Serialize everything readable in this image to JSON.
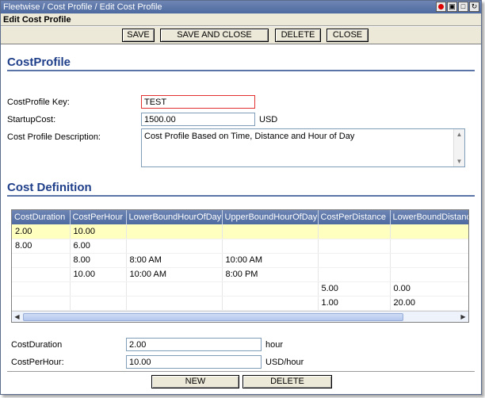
{
  "window": {
    "breadcrumb": "Fleetwise / Cost Profile / Edit Cost Profile",
    "subtitle": "Edit Cost Profile"
  },
  "toolbar": {
    "save": "SAVE",
    "save_close": "SAVE AND CLOSE",
    "delete": "DELETE",
    "close": "CLOSE"
  },
  "cost_profile": {
    "heading": "CostProfile",
    "key_label": "CostProfile Key:",
    "key_value": "TEST",
    "startup_label": "StartupCost:",
    "startup_value": "1500.00",
    "startup_unit": "USD",
    "desc_label": "Cost Profile Description:",
    "desc_value": "Cost Profile Based on Time, Distance and Hour of Day"
  },
  "cost_definition": {
    "heading": "Cost Definition",
    "columns": [
      "CostDuration",
      "CostPerHour",
      "LowerBoundHourOfDay",
      "UpperBoundHourOfDay",
      "CostPerDistance",
      "LowerBoundDistance"
    ],
    "rows": [
      [
        "2.00",
        "10.00",
        "",
        "",
        "",
        ""
      ],
      [
        "8.00",
        "6.00",
        "",
        "",
        "",
        ""
      ],
      [
        "",
        "8.00",
        "8:00 AM",
        "10:00 AM",
        "",
        ""
      ],
      [
        "",
        "10.00",
        "10:00 AM",
        "8:00 PM",
        "",
        ""
      ],
      [
        "",
        "",
        "",
        "",
        "5.00",
        "0.00"
      ],
      [
        "",
        "",
        "",
        "",
        "1.00",
        "20.00"
      ]
    ],
    "selected_row": 0
  },
  "detail": {
    "duration_label": "CostDuration",
    "duration_value": "2.00",
    "duration_unit": "hour",
    "perhour_label": "CostPerHour:",
    "perhour_value": "10.00",
    "perhour_unit": "USD/hour",
    "new": "NEW",
    "delete": "DELETE"
  },
  "colors": {
    "titlebar": "#4d6aa0",
    "heading": "#1f3f8a",
    "selected_row": "#ffffc0",
    "error_border": "#e03030"
  }
}
